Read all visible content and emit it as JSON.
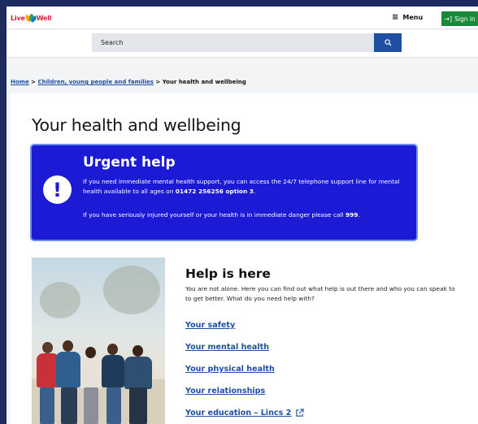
{
  "header": {
    "logo_text_1": "Live",
    "logo_text_2": "Well",
    "menu_label": "Menu",
    "signin_label": "Sign in"
  },
  "search": {
    "placeholder": "Search"
  },
  "breadcrumb": {
    "items": [
      "Home",
      "Children, young people and families"
    ],
    "separator": ">",
    "current": "Your health and wellbeing"
  },
  "page": {
    "title": "Your health and wellbeing"
  },
  "urgent": {
    "heading": "Urgent help",
    "p1_text": "If you need immediate mental health support, you can access the 24/7 telephone support line for mental health available to all ages on ",
    "p1_bold": "01472 256256 option 3",
    "p1_end": ".",
    "p2_text": "If you have seriously injured yourself or your health is in immediate danger please call ",
    "p2_bold": "999",
    "p2_end": ".",
    "color": "#1c1ad4"
  },
  "help": {
    "heading": "Help is here",
    "intro": "You are not alone. Here you can find out what help is out there and who you can speak to to get better. What do you need help with?",
    "links": [
      "Your safety",
      "Your mental health",
      "Your physical health",
      "Your relationships",
      "Your education – Lincs 2"
    ],
    "external_icon": "external-link-icon"
  },
  "colors": {
    "link": "#1f4fa3",
    "signin": "#1a8a3a",
    "background": "#1d2b5e"
  }
}
